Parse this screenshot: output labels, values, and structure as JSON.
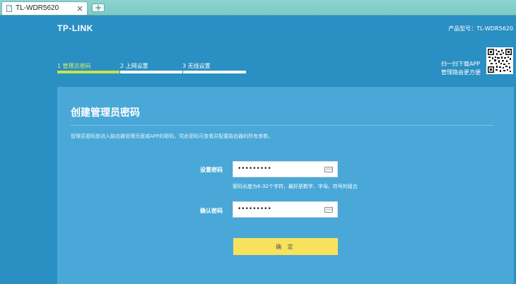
{
  "browser": {
    "tab_title": "TL-WDR5620",
    "close_glyph": "×",
    "new_tab_glyph": "+"
  },
  "header": {
    "logo": "TP-LINK",
    "model": "产品型号：TL-WDR5620"
  },
  "steps": [
    {
      "label": "1 管理员密码",
      "active": true
    },
    {
      "label": "2 上网设置",
      "active": false
    },
    {
      "label": "3 无线设置",
      "active": false
    }
  ],
  "qr": {
    "line1": "扫一扫下载APP",
    "line2": "管理路由更方便",
    "icon": "qr-code-icon"
  },
  "form": {
    "title": "创建管理员密码",
    "description": "管理员密码是进入路由器管理页面或APP的密码，凭此密码可查看并配置路由器的所有参数。",
    "password_label": "设置密码",
    "password_value": "•••••••••",
    "password_hint": "密码长度为6-32个字符，最好是数字、字母、符号的组合",
    "confirm_label": "确认密码",
    "confirm_value": "•••••••••",
    "submit_label": "确 定"
  },
  "colors": {
    "background": "#2a8fc2",
    "card": "#4aa8d8",
    "active_step": "#c7e24a",
    "button": "#f8e15c"
  }
}
